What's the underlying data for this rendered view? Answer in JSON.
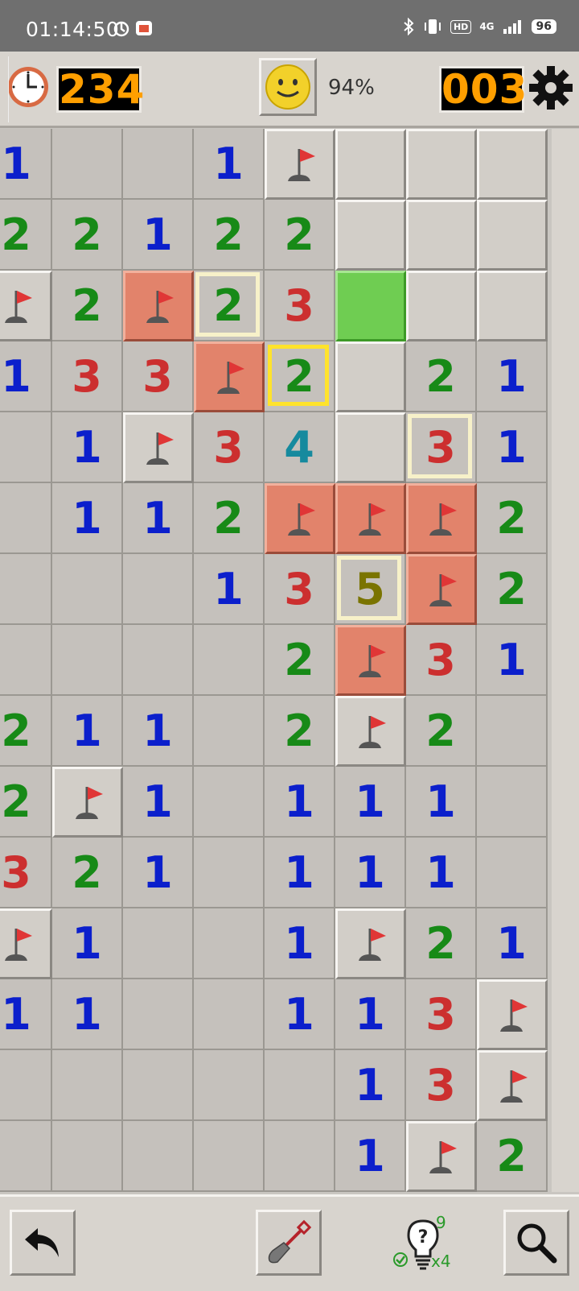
{
  "status_bar": {
    "time": "01:14:50",
    "network": "4G",
    "hd_label": "HD",
    "battery": "96"
  },
  "header": {
    "timer": "234",
    "progress": "94%",
    "mines_left": "003"
  },
  "footer": {
    "hint_count": "9",
    "hint_multiplier": "x4"
  },
  "colors": {
    "1": "#0b1fcc",
    "2": "#178a17",
    "3": "#cc2f2f",
    "4": "#168a9e",
    "5": "#7a7400"
  },
  "board": {
    "cols": 8,
    "rows": 15,
    "legend": "o = opened empty, digit = opened number, F = flag, R = flag on red tile, C = covered, G = green covered, y/c suffix = yellow/cream highlight",
    "grid": [
      [
        "1",
        "o",
        "o",
        "1",
        "F",
        "C",
        "C",
        "C"
      ],
      [
        "2",
        "2",
        "1",
        "2",
        "2",
        "C",
        "C",
        "C"
      ],
      [
        "F",
        "2",
        "R",
        "2c",
        "3",
        "G",
        "C",
        "C"
      ],
      [
        "1",
        "3",
        "3",
        "R",
        "2y",
        "C",
        "2",
        "1"
      ],
      [
        "o",
        "1",
        "F",
        "3",
        "4",
        "C",
        "3c",
        "1"
      ],
      [
        "o",
        "1",
        "1",
        "2",
        "R",
        "R",
        "R",
        "2"
      ],
      [
        "o",
        "o",
        "o",
        "1",
        "3",
        "5c",
        "R",
        "2"
      ],
      [
        "o",
        "o",
        "o",
        "o",
        "2",
        "R",
        "3",
        "1"
      ],
      [
        "2",
        "1",
        "1",
        "o",
        "2",
        "F",
        "2",
        "o"
      ],
      [
        "2",
        "F",
        "1",
        "o",
        "1",
        "1",
        "1",
        "o"
      ],
      [
        "3",
        "2",
        "1",
        "o",
        "1",
        "1",
        "1",
        "o"
      ],
      [
        "F",
        "1",
        "o",
        "o",
        "1",
        "F",
        "2",
        "1"
      ],
      [
        "1",
        "1",
        "o",
        "o",
        "1",
        "1",
        "3",
        "F"
      ],
      [
        "o",
        "o",
        "o",
        "o",
        "o",
        "1",
        "3",
        "F"
      ],
      [
        "o",
        "o",
        "o",
        "o",
        "o",
        "1",
        "F",
        "2"
      ]
    ]
  }
}
